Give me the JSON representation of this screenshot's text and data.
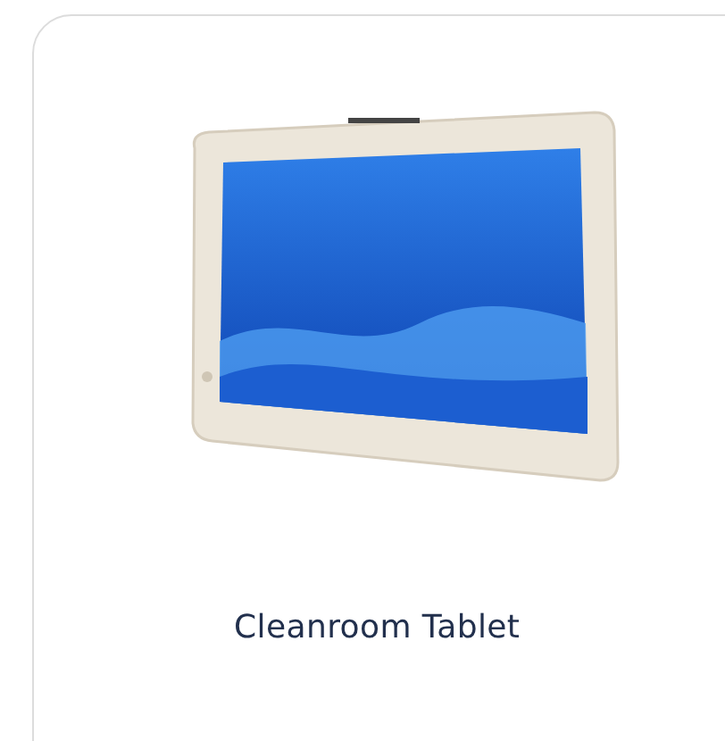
{
  "product_card": {
    "title": "Cleanroom Tablet"
  }
}
